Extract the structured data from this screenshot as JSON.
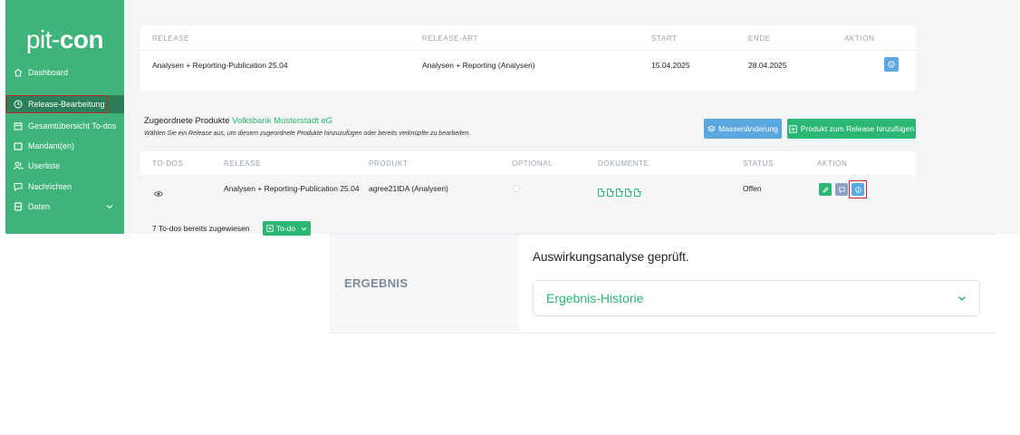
{
  "sidebar": {
    "logo_prefix": "pit-",
    "logo_bold": "con",
    "items": [
      {
        "label": "Dashboard",
        "icon": "home-icon"
      },
      {
        "label": "Release-Bearbeitung",
        "icon": "clock-icon"
      },
      {
        "label": "Gesamtübersicht To-dos",
        "icon": "calendar-icon"
      },
      {
        "label": "Mandant(en)",
        "icon": "folder-icon"
      },
      {
        "label": "Userliste",
        "icon": "users-icon"
      },
      {
        "label": "Nachrichten",
        "icon": "message-icon"
      },
      {
        "label": "Daten",
        "icon": "database-icon"
      }
    ]
  },
  "release_table": {
    "headers": [
      "RELEASE",
      "RELEASE-ART",
      "START",
      "ENDE",
      "AKTION"
    ],
    "row": {
      "release": "Analysen + Reporting-Publication 25.04",
      "release_art": "Analysen + Reporting (Analysen)",
      "start": "15.04.2025",
      "ende": "28.04.2025"
    }
  },
  "products": {
    "title": "Zugeordnete Produkte",
    "bank": "Volksbank Musterstadt eG",
    "hint": "Wählen Sie ein Release aus, um diesem zugeordnete Produkte hinzuzufügen oder bereits verknüpfte zu bearbeiten.",
    "mass_button": "Massenänderung",
    "add_button": "Produkt zum Release hinzufügen",
    "headers": [
      "TO-DOS",
      "RELEASE",
      "PRODUKT",
      "OPTIONAL",
      "DOKUMENTE",
      "STATUS",
      "AKTION"
    ],
    "row": {
      "release": "Analysen + Reporting-Publication 25.04",
      "produkt": "agree21IDA (Analysen)",
      "status": "Offen",
      "document_count": 5
    },
    "todos_assigned": "7 To-dos bereits zugewiesen",
    "todo_button": "To-do"
  },
  "result_panel": {
    "label": "ERGEBNIS",
    "text": "Auswirkungsanalyse geprüft.",
    "accordion_label": "Ergebnis-Historie"
  },
  "colors": {
    "sidebar": "#3eb37a",
    "accent_green": "#2bb673",
    "button_blue": "#5ba7e0",
    "highlight_red": "#c62828"
  }
}
